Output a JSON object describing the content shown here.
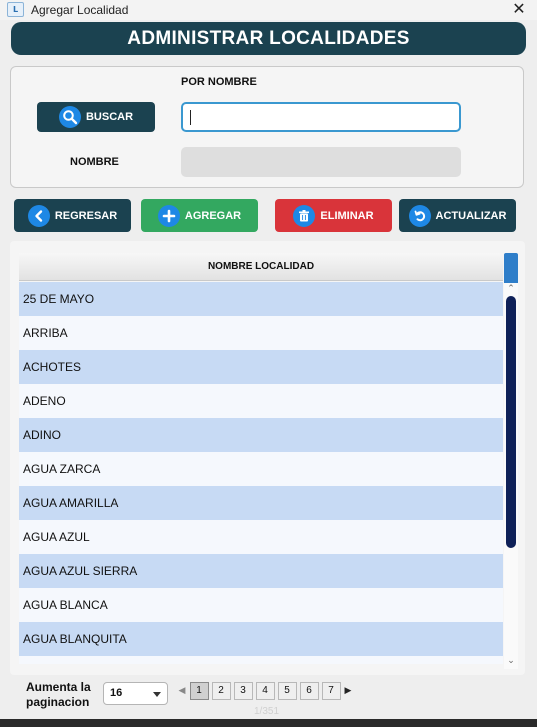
{
  "window": {
    "title": "Agregar Localidad",
    "close_glyph": "✕"
  },
  "header": {
    "title": "ADMINISTRAR LOCALIDADES"
  },
  "search": {
    "by_name_label": "POR NOMBRE",
    "search_button": "BUSCAR",
    "search_value": "",
    "name_label": "NOMBRE",
    "name_value": ""
  },
  "actions": {
    "back": "REGRESAR",
    "add": "AGREGAR",
    "delete": "ELIMINAR",
    "refresh": "ACTUALIZAR"
  },
  "table": {
    "column_header": "NOMBRE LOCALIDAD",
    "rows": [
      "25 DE MAYO",
      "ARRIBA",
      "ACHOTES",
      "ADENO",
      "ADINO",
      "AGUA  ZARCA",
      "AGUA AMARILLA",
      "AGUA AZUL",
      "AGUA AZUL SIERRA",
      "AGUA BLANCA",
      "AGUA BLANQUITA",
      ""
    ]
  },
  "pagination": {
    "label_line1": "Aumenta la",
    "label_line2": "paginacion",
    "page_size": "16",
    "pages": [
      "1",
      "2",
      "3",
      "4",
      "5",
      "6",
      "7"
    ],
    "current_page": "1",
    "indicator": "1/351"
  },
  "icons": {
    "buscar": "magnifier-icon",
    "regresar": "chevron-left-icon",
    "agregar": "plus-icon",
    "eliminar": "trash-icon",
    "actualizar": "refresh-icon"
  },
  "colors": {
    "dark_teal": "#1b4250",
    "green": "#33a860",
    "red": "#d9343a",
    "row_highlight": "#c7daf4",
    "scroll_thumb": "#0f2158",
    "icon_blue": "#1e88e5"
  }
}
